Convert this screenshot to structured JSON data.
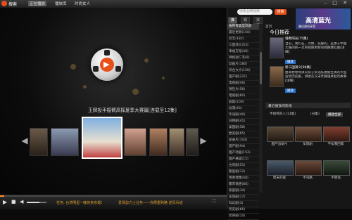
{
  "app": {
    "title": "搜索"
  },
  "menu": [
    "正在播放",
    "播放库",
    "时尚女人"
  ],
  "window_controls": [
    "–",
    "□",
    "✕"
  ],
  "video": {
    "title": "王牌投手振臂高挥夏季大赛篇[连载至12集]"
  },
  "controls": {
    "ticker1": "任务: 台湾明星一晚的亲东婚!",
    "ticker2": "爱情剪力士业务——你那重购路·逆风兵道"
  },
  "search": {
    "placeholder": "搜索全网视频",
    "button": "搜索"
  },
  "ad": {
    "text": "高清蓝光",
    "sub": "最佳视听享受"
  },
  "tabs": [
    "推荐",
    "频道",
    "资讯"
  ],
  "categories": [
    "按所有类型浏览",
    "最近更新(150)",
    "综艺(182)",
    "三国演义(63)",
    "幸福方程(48)",
    "神探狄仁杰(9)",
    "动画片(180)",
    "综合大片(150)",
    "国产剧(221)",
    "电视剧(46)",
    "预告片(56)",
    "电视剧(60)",
    "剧集(100)",
    "动漫(40)",
    "华语剧(40)",
    "日韩剧(41)",
    "泰国剧(58)",
    "欧美剧(65)",
    "纪录片(103)",
    "国产剧(94)",
    "国产动画(152)",
    "国产悬疑(15)",
    "古装剧(51)",
    "警匪剧(12)",
    "青春偶像(48)",
    "都市情感(80)",
    "家庭剧(34)",
    "军旅剧(17)",
    "科幻剧(3)",
    "历史剧(66)",
    "武侠剧(10)"
  ],
  "right": {
    "breadcrumb": "首页",
    "section": "今日推荐",
    "items": [
      {
        "title": "魂断阳光(75集)",
        "desc": "当前，我们在，以情，说服的，是源于中国大陆的的一次的视频更新的网路爆红剧[详细]",
        "play": "播放"
      },
      {
        "title": "新三国演义[86集]",
        "desc": "由高希希导演以及于荣光陈建斌主演的大型古装历史剧，讲述东汉末年群雄并起的故事[详细]",
        "play": "播放"
      }
    ],
    "list_header": "最近播放的影视",
    "list_sub": "(分集)",
    "list_item": "不怕死的人(13集)",
    "list_btn": "播放全部",
    "grid": [
      "国产战争片",
      "军旅剧",
      "不如我回家",
      "周末的家",
      "不归路",
      "不倒翁"
    ]
  },
  "colors": {
    "accent": "#e8501a",
    "progress": "#ff8c1a",
    "play": "#2a70c8"
  }
}
